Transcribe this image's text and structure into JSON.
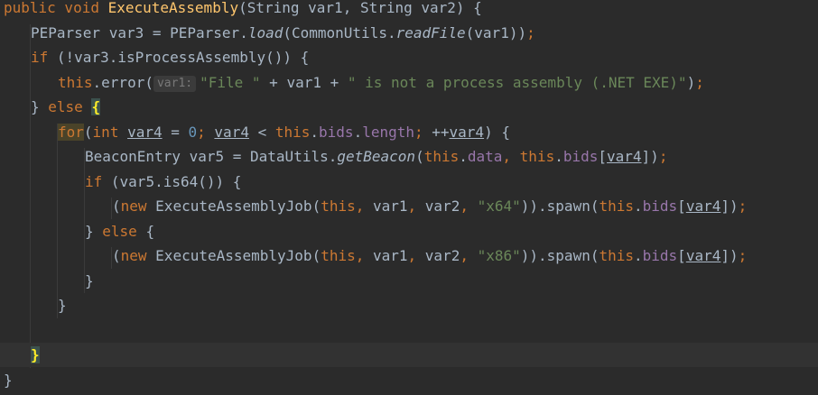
{
  "code": {
    "lines": [
      {
        "indent": 0,
        "tokens": [
          {
            "text": "public void ",
            "cls": "kw"
          },
          {
            "text": "ExecuteAssembly",
            "cls": "fn"
          },
          {
            "text": "(String var1, String var2) {"
          }
        ]
      },
      {
        "indent": 1,
        "tokens": [
          {
            "text": "PEParser var3 = PEParser."
          },
          {
            "text": "load",
            "cls": "it"
          },
          {
            "text": "(CommonUtils."
          },
          {
            "text": "readFile",
            "cls": "it"
          },
          {
            "text": "(var1))"
          },
          {
            "text": ";",
            "cls": "kw"
          }
        ]
      },
      {
        "indent": 1,
        "tokens": [
          {
            "text": "if ",
            "cls": "kw"
          },
          {
            "text": "(!var3.isProcessAssembly()) {"
          }
        ]
      },
      {
        "indent": 2,
        "tokens": [
          {
            "text": "this",
            "cls": "kw"
          },
          {
            "text": ".error("
          },
          {
            "text": "var1:",
            "cls": "hint"
          },
          {
            "text": "\"File \"",
            "cls": "st"
          },
          {
            "text": " + var1 + "
          },
          {
            "text": "\" is not a process assembly (.NET EXE)\"",
            "cls": "st"
          },
          {
            "text": ")"
          },
          {
            "text": ";",
            "cls": "kw"
          }
        ]
      },
      {
        "indent": 1,
        "tokens": [
          {
            "text": "} "
          },
          {
            "text": "else ",
            "cls": "kw"
          },
          {
            "text": "{",
            "cls": "bm"
          }
        ]
      },
      {
        "indent": 2,
        "tokens": [
          {
            "text": "for",
            "cls": "kw hl"
          },
          {
            "text": "("
          },
          {
            "text": "int ",
            "cls": "kw"
          },
          {
            "text": "var4",
            "cls": "ul"
          },
          {
            "text": " = "
          },
          {
            "text": "0",
            "cls": "num"
          },
          {
            "text": "; ",
            "cls": "kw"
          },
          {
            "text": "var4",
            "cls": "ul"
          },
          {
            "text": " < "
          },
          {
            "text": "this",
            "cls": "kw"
          },
          {
            "text": "."
          },
          {
            "text": "bids",
            "cls": "fld"
          },
          {
            "text": "."
          },
          {
            "text": "length",
            "cls": "fld"
          },
          {
            "text": "; ",
            "cls": "kw"
          },
          {
            "text": "++"
          },
          {
            "text": "var4",
            "cls": "ul"
          },
          {
            "text": ") {"
          }
        ]
      },
      {
        "indent": 3,
        "tokens": [
          {
            "text": "BeaconEntry var5 = DataUtils."
          },
          {
            "text": "getBeacon",
            "cls": "it"
          },
          {
            "text": "("
          },
          {
            "text": "this",
            "cls": "kw"
          },
          {
            "text": "."
          },
          {
            "text": "data",
            "cls": "fld"
          },
          {
            "text": ", ",
            "cls": "kw"
          },
          {
            "text": "this",
            "cls": "kw"
          },
          {
            "text": "."
          },
          {
            "text": "bids",
            "cls": "fld"
          },
          {
            "text": "["
          },
          {
            "text": "var4",
            "cls": "ul"
          },
          {
            "text": "])"
          },
          {
            "text": ";",
            "cls": "kw"
          }
        ]
      },
      {
        "indent": 3,
        "tokens": [
          {
            "text": "if ",
            "cls": "kw"
          },
          {
            "text": "(var5.is64()) {"
          }
        ]
      },
      {
        "indent": 4,
        "tokens": [
          {
            "text": "("
          },
          {
            "text": "new ",
            "cls": "kw"
          },
          {
            "text": "ExecuteAssemblyJob("
          },
          {
            "text": "this",
            "cls": "kw"
          },
          {
            "text": ", ",
            "cls": "kw"
          },
          {
            "text": "var1"
          },
          {
            "text": ", ",
            "cls": "kw"
          },
          {
            "text": "var2"
          },
          {
            "text": ", ",
            "cls": "kw"
          },
          {
            "text": "\"x64\"",
            "cls": "st"
          },
          {
            "text": ")).spawn("
          },
          {
            "text": "this",
            "cls": "kw"
          },
          {
            "text": "."
          },
          {
            "text": "bids",
            "cls": "fld"
          },
          {
            "text": "["
          },
          {
            "text": "var4",
            "cls": "ul"
          },
          {
            "text": "])"
          },
          {
            "text": ";",
            "cls": "kw"
          }
        ]
      },
      {
        "indent": 3,
        "tokens": [
          {
            "text": "} "
          },
          {
            "text": "else ",
            "cls": "kw"
          },
          {
            "text": "{"
          }
        ]
      },
      {
        "indent": 4,
        "tokens": [
          {
            "text": "("
          },
          {
            "text": "new ",
            "cls": "kw"
          },
          {
            "text": "ExecuteAssemblyJob("
          },
          {
            "text": "this",
            "cls": "kw"
          },
          {
            "text": ", ",
            "cls": "kw"
          },
          {
            "text": "var1"
          },
          {
            "text": ", ",
            "cls": "kw"
          },
          {
            "text": "var2"
          },
          {
            "text": ", ",
            "cls": "kw"
          },
          {
            "text": "\"x86\"",
            "cls": "st"
          },
          {
            "text": ")).spawn("
          },
          {
            "text": "this",
            "cls": "kw"
          },
          {
            "text": "."
          },
          {
            "text": "bids",
            "cls": "fld"
          },
          {
            "text": "["
          },
          {
            "text": "var4",
            "cls": "ul"
          },
          {
            "text": "])"
          },
          {
            "text": ";",
            "cls": "kw"
          }
        ]
      },
      {
        "indent": 3,
        "tokens": [
          {
            "text": "}"
          }
        ]
      },
      {
        "indent": 2,
        "tokens": [
          {
            "text": "}"
          }
        ]
      },
      {
        "indent": 0,
        "tokens": []
      },
      {
        "indent": 1,
        "current": true,
        "tokens": [
          {
            "text": "}",
            "cls": "bm"
          }
        ]
      },
      {
        "indent": 0,
        "tokens": [
          {
            "text": "}"
          }
        ]
      }
    ]
  },
  "theme": {
    "background": "#2b2b2b",
    "text": "#a9b7c6",
    "keyword": "#cc7832",
    "method_declaration": "#ffc66d",
    "string": "#6a8759",
    "number": "#6897bb",
    "field": "#9876aa"
  }
}
